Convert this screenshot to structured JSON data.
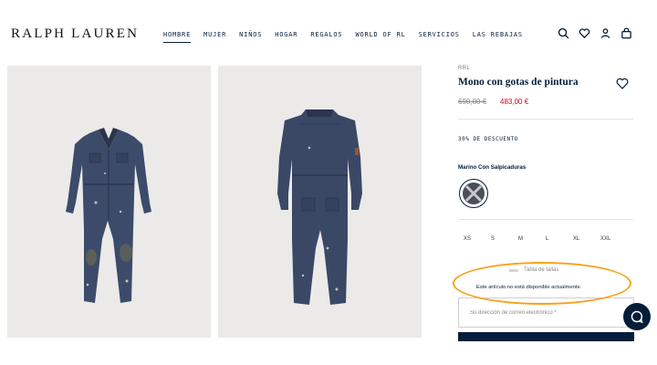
{
  "header": {
    "brand": "RALPH LAUREN",
    "nav": [
      "HOMBRE",
      "MUJER",
      "NIÑOS",
      "HOGAR",
      "REGALOS",
      "WORLD OF RL",
      "SERVICIOS",
      "LAS REBAJAS"
    ],
    "active_nav": "HOMBRE",
    "icons": [
      "search-icon",
      "heart-icon",
      "account-icon",
      "bag-icon"
    ]
  },
  "gallery": {
    "images": [
      "coverall-front",
      "coverall-back"
    ]
  },
  "product": {
    "brand": "RRL",
    "title": "Mono con gotas de pintura",
    "price_old": "690,00 €",
    "price_new": "483,00 €",
    "discount": "30% DE DESCUENTO",
    "color_name": "Marino Con Salpicaduras",
    "sizes": [
      "XS",
      "S",
      "M",
      "L",
      "XL",
      "XXL"
    ],
    "size_chart_label": "Tabla de tallas",
    "unavailable_msg": "Este artículo no está disponible actualmente.",
    "email_placeholder": "Su dirección de correo electrónico *"
  },
  "colors": {
    "navy": "#041e3a",
    "sale_red": "#d0021b",
    "annotation": "#f5a31a",
    "image_bg": "#ebeae8"
  }
}
